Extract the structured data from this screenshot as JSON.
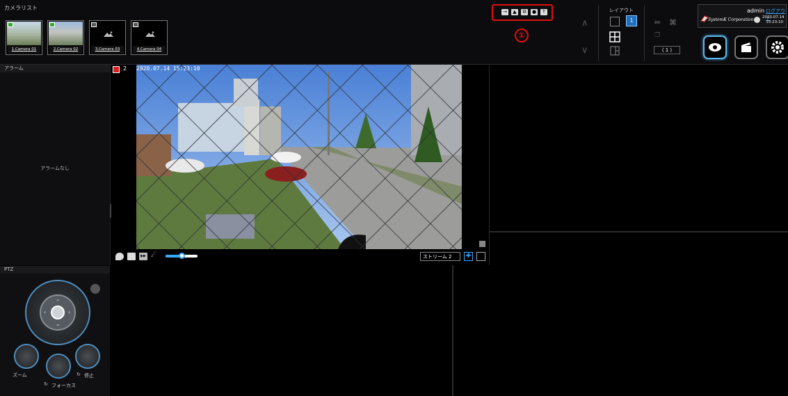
{
  "camera_list": {
    "title": "カメラリスト",
    "cameras": [
      {
        "label": "1.Camera 01",
        "status": "active"
      },
      {
        "label": "2.Camera 02",
        "status": "active"
      },
      {
        "label": "3.Camera 03",
        "status": "no-image"
      },
      {
        "label": "4.Camera 04",
        "status": "no-image"
      }
    ]
  },
  "toolbar": {
    "annotation_number": "①",
    "buttons": [
      "export-icon",
      "car-icon",
      "settings-icon",
      "record-icon",
      "info-icon"
    ]
  },
  "layout": {
    "title": "レイアウト",
    "page_indicator": "1",
    "selected": "4"
  },
  "user": {
    "name": "admin",
    "logout": "ログアウト",
    "corporation": "SystemK Corporation",
    "date": "2020.07.14",
    "time": "15:23:10"
  },
  "alarm": {
    "title": "アラーム",
    "empty_text": "アラームなし"
  },
  "video": {
    "camera_number": "2",
    "timestamp": "2020.07.14 15:23:10",
    "stream": "ストリーム 2",
    "volume_percent": 50
  },
  "ptz": {
    "title": "PTZ",
    "zoom_label": "ズーム",
    "focus_label": "フォーカス",
    "stop_label": "停止"
  },
  "colors": {
    "accent": "#3aa7ff",
    "annotation_red": "#e01010",
    "ptz_ring": "#4f8fbf"
  }
}
